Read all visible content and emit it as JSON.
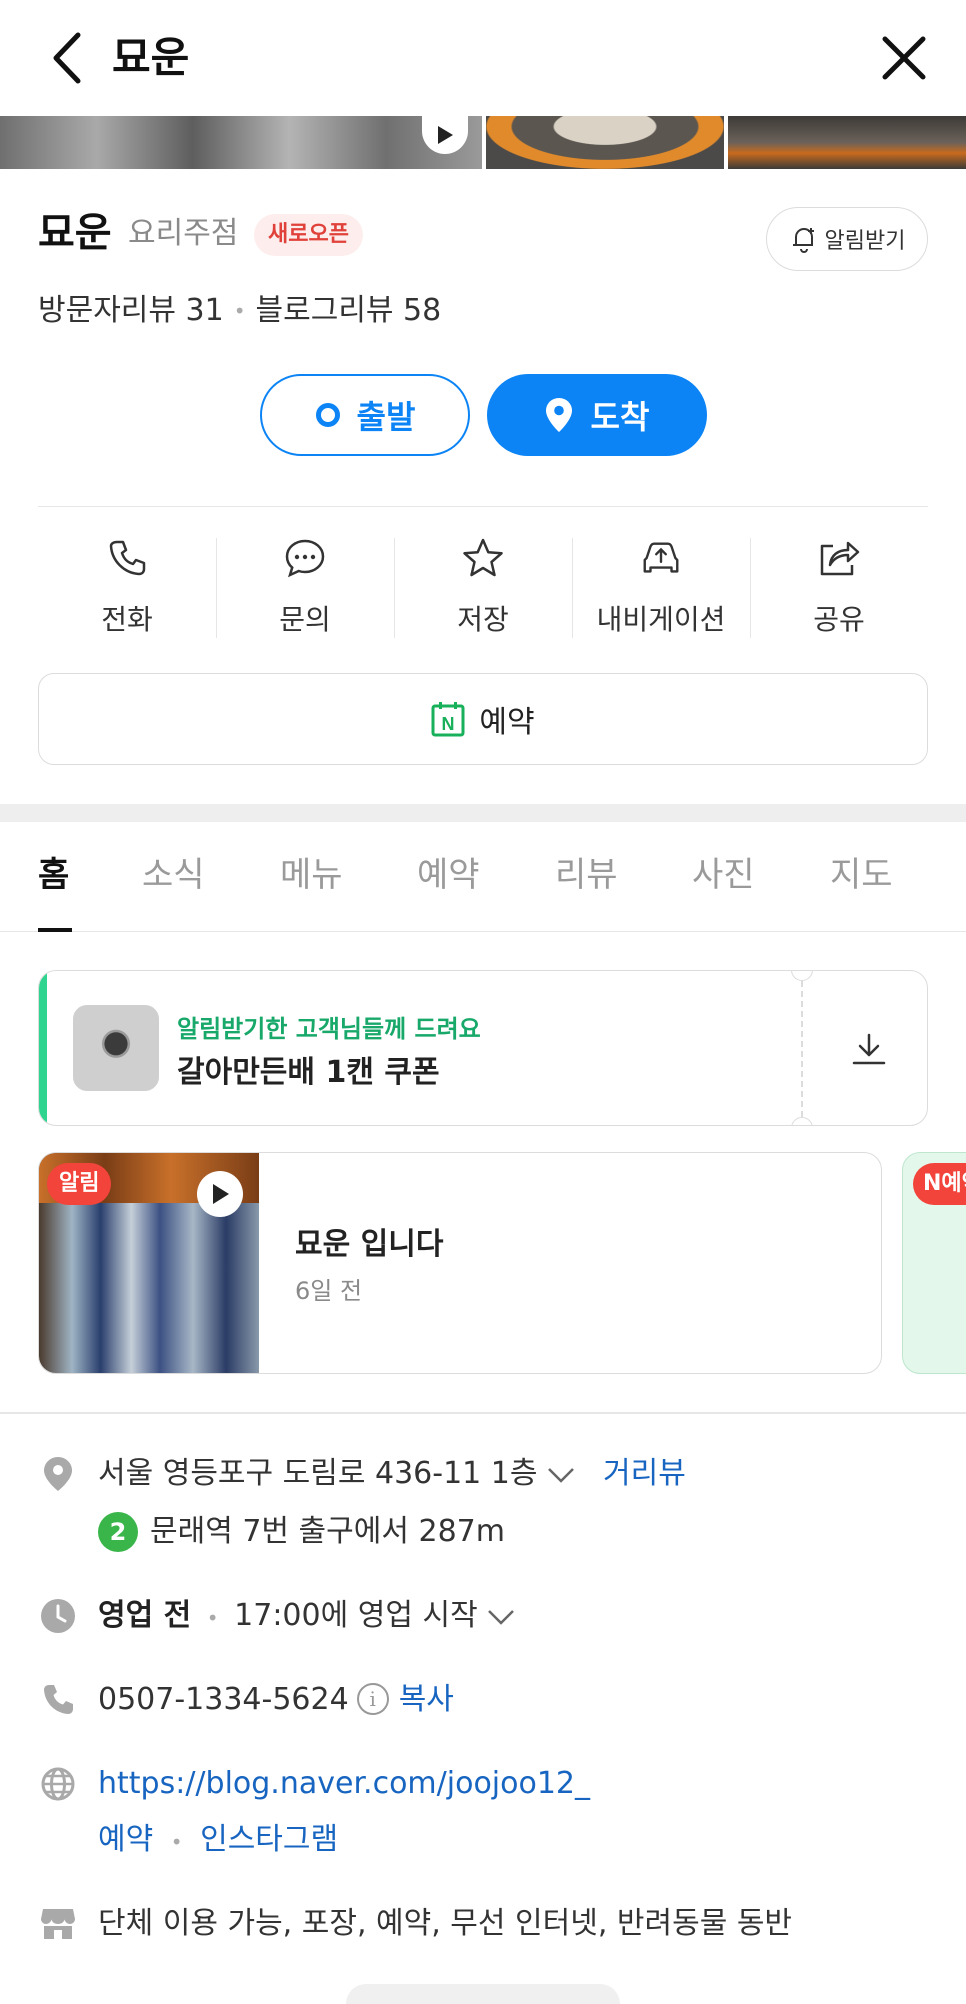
{
  "header": {
    "title": "묘운"
  },
  "place": {
    "name": "묘운",
    "category": "요리주점",
    "badge": "새로오픈",
    "notify_label": "알림받기",
    "visitor_reviews": "방문자리뷰 31",
    "blog_reviews": "블로그리뷰 58",
    "depart_label": "출발",
    "arrive_label": "도착"
  },
  "actions": [
    {
      "label": "전화",
      "icon": "phone-icon"
    },
    {
      "label": "문의",
      "icon": "chat-icon"
    },
    {
      "label": "저장",
      "icon": "star-icon"
    },
    {
      "label": "내비게이션",
      "icon": "car-icon"
    },
    {
      "label": "공유",
      "icon": "share-icon"
    }
  ],
  "reserve": {
    "label": "예약",
    "icon_letter": "N"
  },
  "tabs": [
    "홈",
    "소식",
    "메뉴",
    "예약",
    "리뷰",
    "사진",
    "지도"
  ],
  "active_tab": "홈",
  "coupon": {
    "subtitle": "알림받기한 고객님들께 드려요",
    "title": "갈아만든배 1캔 쿠폰"
  },
  "news": {
    "badge": "알림",
    "title": "묘운 입니다",
    "time": "6일 전",
    "next_badge": "N예약"
  },
  "info": {
    "address": "서울 영등포구 도림로 436-11 1층",
    "street_view": "거리뷰",
    "subway_line": "2",
    "subway_text": "문래역 7번 출구에서 287m",
    "hours_status": "영업 전",
    "hours_text": "17:00에 영업 시작",
    "phone": "0507-1334-5624",
    "copy_label": "복사",
    "info_glyph": "i",
    "website": "https://blog.naver.com/joojoo12_",
    "link_reserve": "예약",
    "link_instagram": "인스타그램",
    "amenities": "단체 이용 가능, 포장, 예약, 무선 인터넷, 반려동물 동반"
  },
  "colors": {
    "primary": "#0c84f5",
    "green": "#17a86a",
    "badge_red": "#e0413a",
    "link": "#1765c0"
  }
}
